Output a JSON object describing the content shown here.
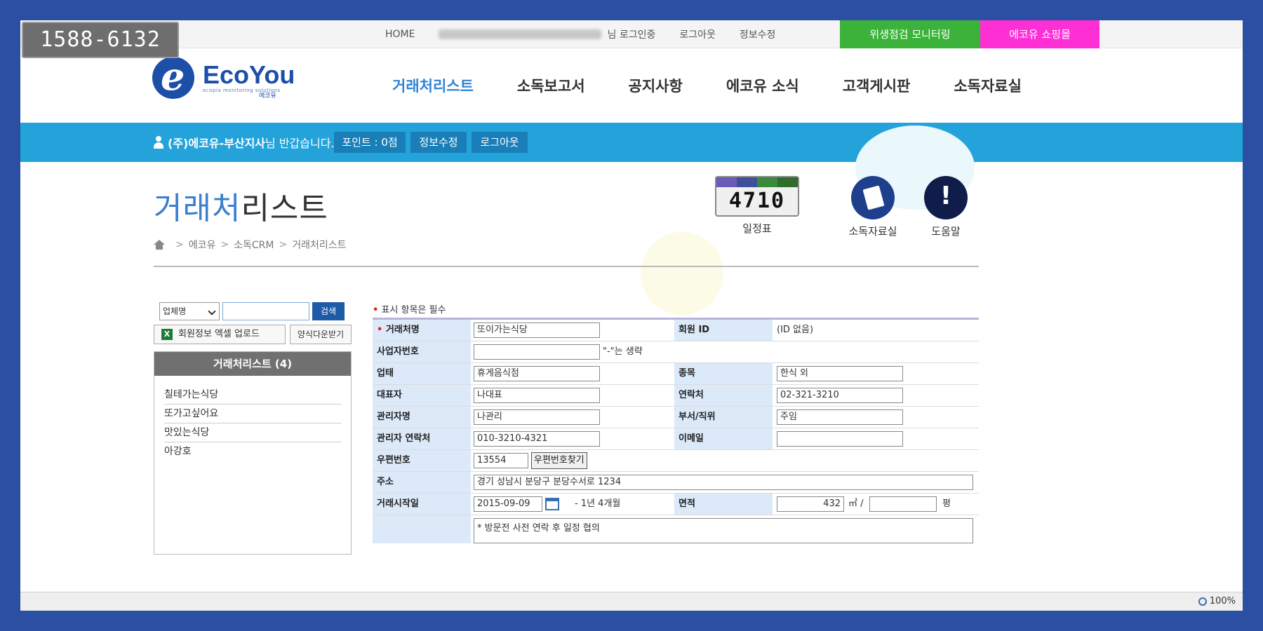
{
  "phone": "1588-6132",
  "topbar": {
    "home": "HOME",
    "login_cert": "님 로그인중",
    "logout": "로그아웃",
    "edit_info": "정보수정",
    "hygiene_btn": "위생점검 모니터링",
    "shop_btn": "에코유 쇼핑몰"
  },
  "logo": {
    "brand": "EcoYou",
    "tagline": "ecopia monitoring solutions",
    "kr": "에코유"
  },
  "gnb": [
    "거래처리스트",
    "소독보고서",
    "공지사항",
    "에코유 소식",
    "고객게시판",
    "소독자료실"
  ],
  "member": {
    "name": "(주)에코유-부산지사",
    "suffix": "님 반갑습니다.",
    "points": "포인트 : 0점",
    "edit": "정보수정",
    "logout": "로그아웃"
  },
  "page": {
    "title_blue": "거래처",
    "title_rest": "리스트",
    "breadcrumb": [
      "에코유",
      "소독CRM",
      "거래처리스트"
    ]
  },
  "quick": {
    "calendar_label": "일정표",
    "calendar_digits": "4710",
    "docs_label": "소독자료실",
    "help_label": "도움말"
  },
  "left": {
    "select_value": "업체명",
    "search_btn": "검색",
    "excel_btn": "회원정보 엑셀 업로드",
    "format_btn": "양식다운받기",
    "list_title": "거래처리스트 (4)",
    "items": [
      "칠테가는식당",
      "또가고싶어요",
      "맛있는식당",
      "아강호"
    ]
  },
  "form": {
    "required_note": "표시 항목은 필수",
    "labels": {
      "client_name": "거래처명",
      "member_id": "회원 ID",
      "biz_no": "사업자번호",
      "industry": "업태",
      "category": "종목",
      "ceo": "대표자",
      "contact": "연락처",
      "manager": "관리자명",
      "dept": "부서/직위",
      "manager_contact": "관리자 연락처",
      "email": "이메일",
      "zip": "우편번호",
      "address": "주소",
      "start_date": "거래시작일",
      "area": "면적"
    },
    "values": {
      "client_name": "또이가는식당",
      "member_id": "(ID 없음)",
      "biz_no": "",
      "biz_no_hint": "\"-\"는 생략",
      "industry": "휴게음식점",
      "category": "한식 외",
      "ceo": "나대표",
      "contact": "02-321-3210",
      "manager": "나관리",
      "dept": "주임",
      "manager_contact": "010-3210-4321",
      "email": "",
      "zip": "13554",
      "zip_btn": "우편번호찾기",
      "address": "경기 성남시 분당구 분당수서로 1234",
      "start_date": "2015-09-09",
      "start_elapsed": "- 1년 4개월",
      "area_m2": "432",
      "area_unit1": "㎡ /",
      "area_pyeong": "",
      "area_unit2": "평",
      "memo": "* 방문전 사전 연락 후 일정 협의"
    }
  },
  "status": {
    "zoom": "100%"
  },
  "colors": {
    "frame": "#2d4fa3",
    "memberbar": "#24a3db",
    "hygiene": "#3bb33a",
    "shop": "#ff2fd6",
    "accent": "#2f83d6"
  }
}
